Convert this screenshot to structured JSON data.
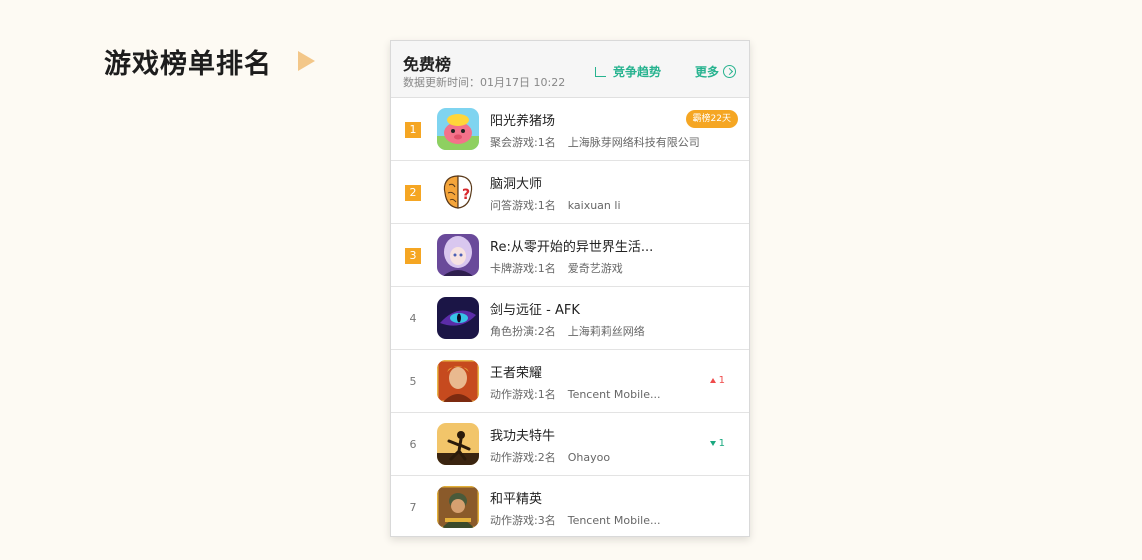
{
  "page": {
    "heading": "游戏榜单排名"
  },
  "card": {
    "title": "免费榜",
    "update_label": "数据更新时间：",
    "update_time": "01月17日 10:22",
    "trend_label": "竞争趋势",
    "more_label": "更多",
    "accent_color": "#27b38f"
  },
  "rows": [
    {
      "rank": "1",
      "name": "阳光养猪场",
      "meta": "聚会游戏:1名",
      "developer": "上海脉芽网络科技有限公司",
      "badge": "霸榜22天",
      "icon": "pig-game-icon"
    },
    {
      "rank": "2",
      "name": "脑洞大师",
      "meta": "问答游戏:1名",
      "developer": "kaixuan li",
      "icon": "brain-puzzle-icon"
    },
    {
      "rank": "3",
      "name": "Re:从零开始的异世界生活...",
      "meta": "卡牌游戏:1名",
      "developer": "爱奇艺游戏",
      "icon": "anime-girl-icon"
    },
    {
      "rank": "4",
      "name": "剑与远征 - AFK",
      "meta": "角色扮演:2名",
      "developer": "上海莉莉丝网络",
      "icon": "dragon-eye-icon"
    },
    {
      "rank": "5",
      "name": "王者荣耀",
      "meta": "动作游戏:1名",
      "developer": "Tencent Mobile...",
      "change": "1",
      "direction": "up",
      "icon": "hero-warrior-icon"
    },
    {
      "rank": "6",
      "name": "我功夫特牛",
      "meta": "动作游戏:2名",
      "developer": "Ohayoo",
      "change": "1",
      "direction": "down",
      "icon": "kungfu-silhouette-icon"
    },
    {
      "rank": "7",
      "name": "和平精英",
      "meta": "动作游戏:3名",
      "developer": "Tencent Mobile...",
      "icon": "soldier-icon"
    }
  ]
}
